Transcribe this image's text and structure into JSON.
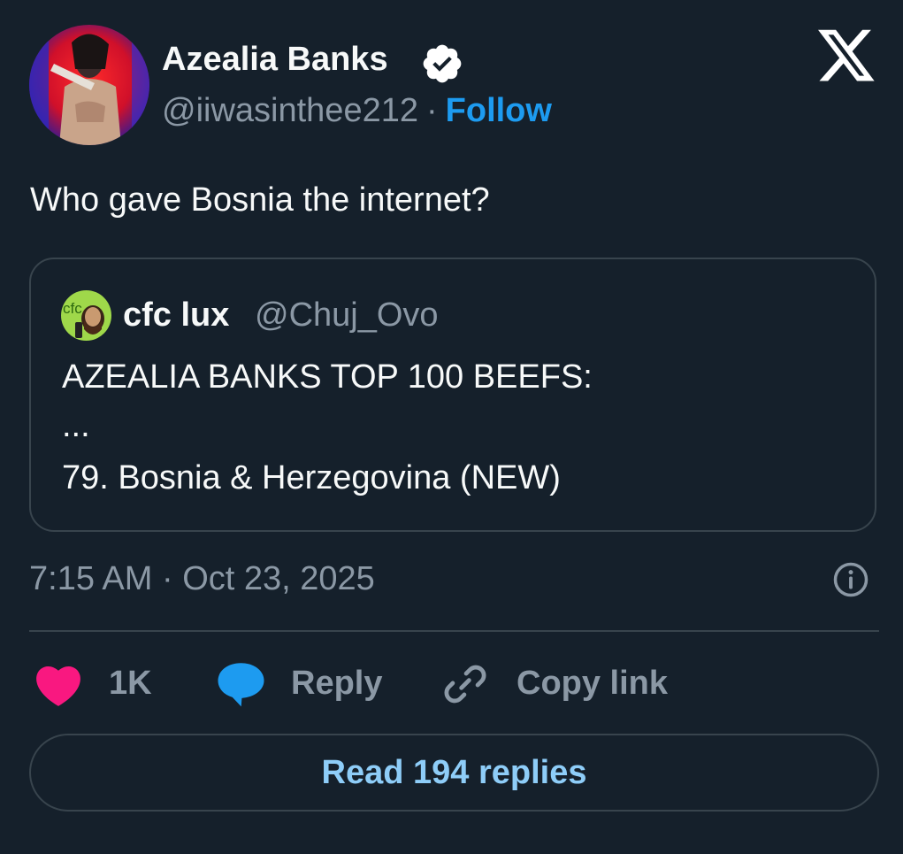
{
  "author": {
    "name": "Azealia Banks",
    "handle": "@iiwasinthee212",
    "separator": "·",
    "follow_label": "Follow",
    "verified_icon": "verified-badge-icon"
  },
  "tweet": {
    "text": "Who gave Bosnia the internet?",
    "timestamp": "7:15 AM · Oct 23, 2025"
  },
  "quote": {
    "name": "cfc lux",
    "handle": "@Chuj_Ovo",
    "lines": [
      "AZEALIA BANKS TOP 100 BEEFS:",
      "...",
      "79. Bosnia & Herzegovina (NEW)"
    ]
  },
  "actions": {
    "likes": "1K",
    "reply_label": "Reply",
    "copy_label": "Copy link"
  },
  "read_replies_label": "Read 194 replies",
  "colors": {
    "background": "#15202b",
    "accent": "#1d9bf0",
    "like": "#f91880",
    "muted": "#8b98a5",
    "border": "#38444d"
  }
}
